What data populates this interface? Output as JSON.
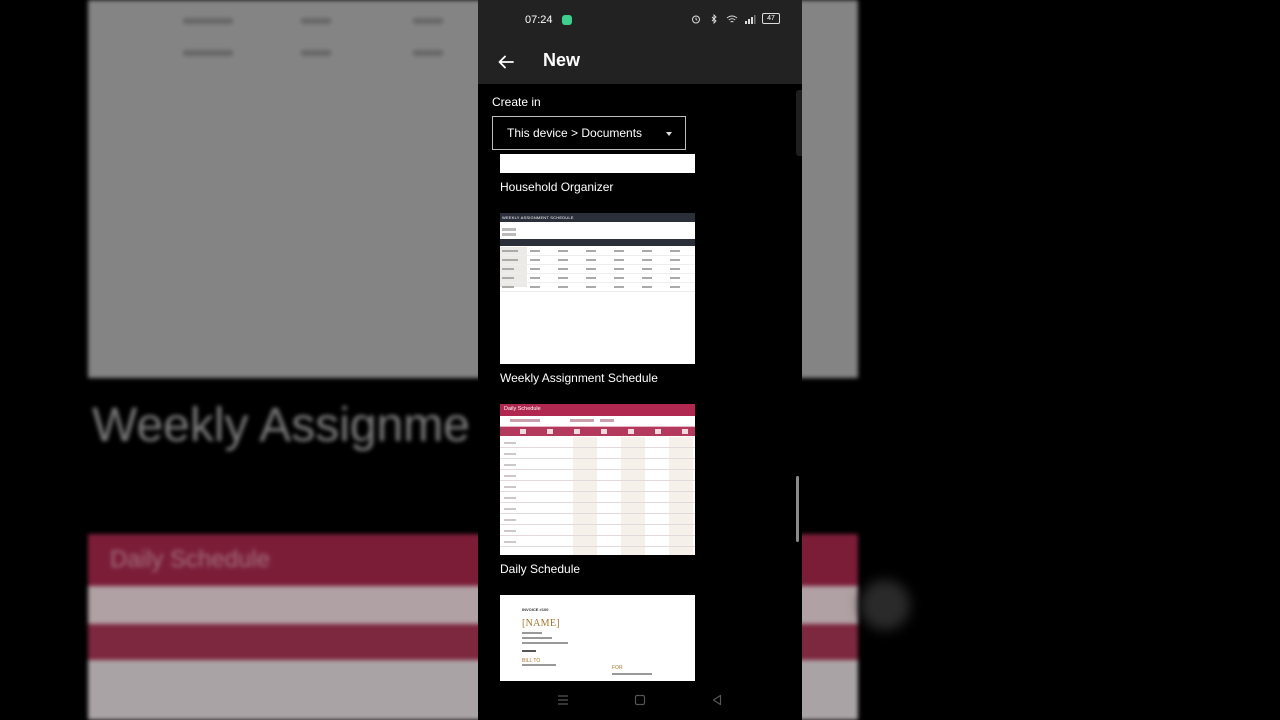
{
  "status_bar": {
    "time": "07:24",
    "battery": "47"
  },
  "app_bar": {
    "title": "New",
    "back_icon": "arrow-left-icon"
  },
  "create_in": {
    "label": "Create in",
    "location": "This device > Documents"
  },
  "templates": [
    {
      "label": "Household Organizer"
    },
    {
      "label": "Weekly Assignment Schedule",
      "thumb_title": "WEEKLY ASSIGNMENT SCHEDULE"
    },
    {
      "label": "Daily Schedule",
      "thumb_title": "Daily Schedule"
    },
    {
      "label": "",
      "thumb_invoice_no": "INVOICE #100",
      "thumb_name": "[NAME]",
      "thumb_bill_to": "BILL TO",
      "thumb_for": "FOR"
    }
  ],
  "background": {
    "title_text": "Weekly Assignme",
    "daily_title": "Daily Schedule"
  },
  "colors": {
    "appbar": "#222222",
    "daily_accent": "#b0284f",
    "weekly_header": "#2a2f3a"
  }
}
